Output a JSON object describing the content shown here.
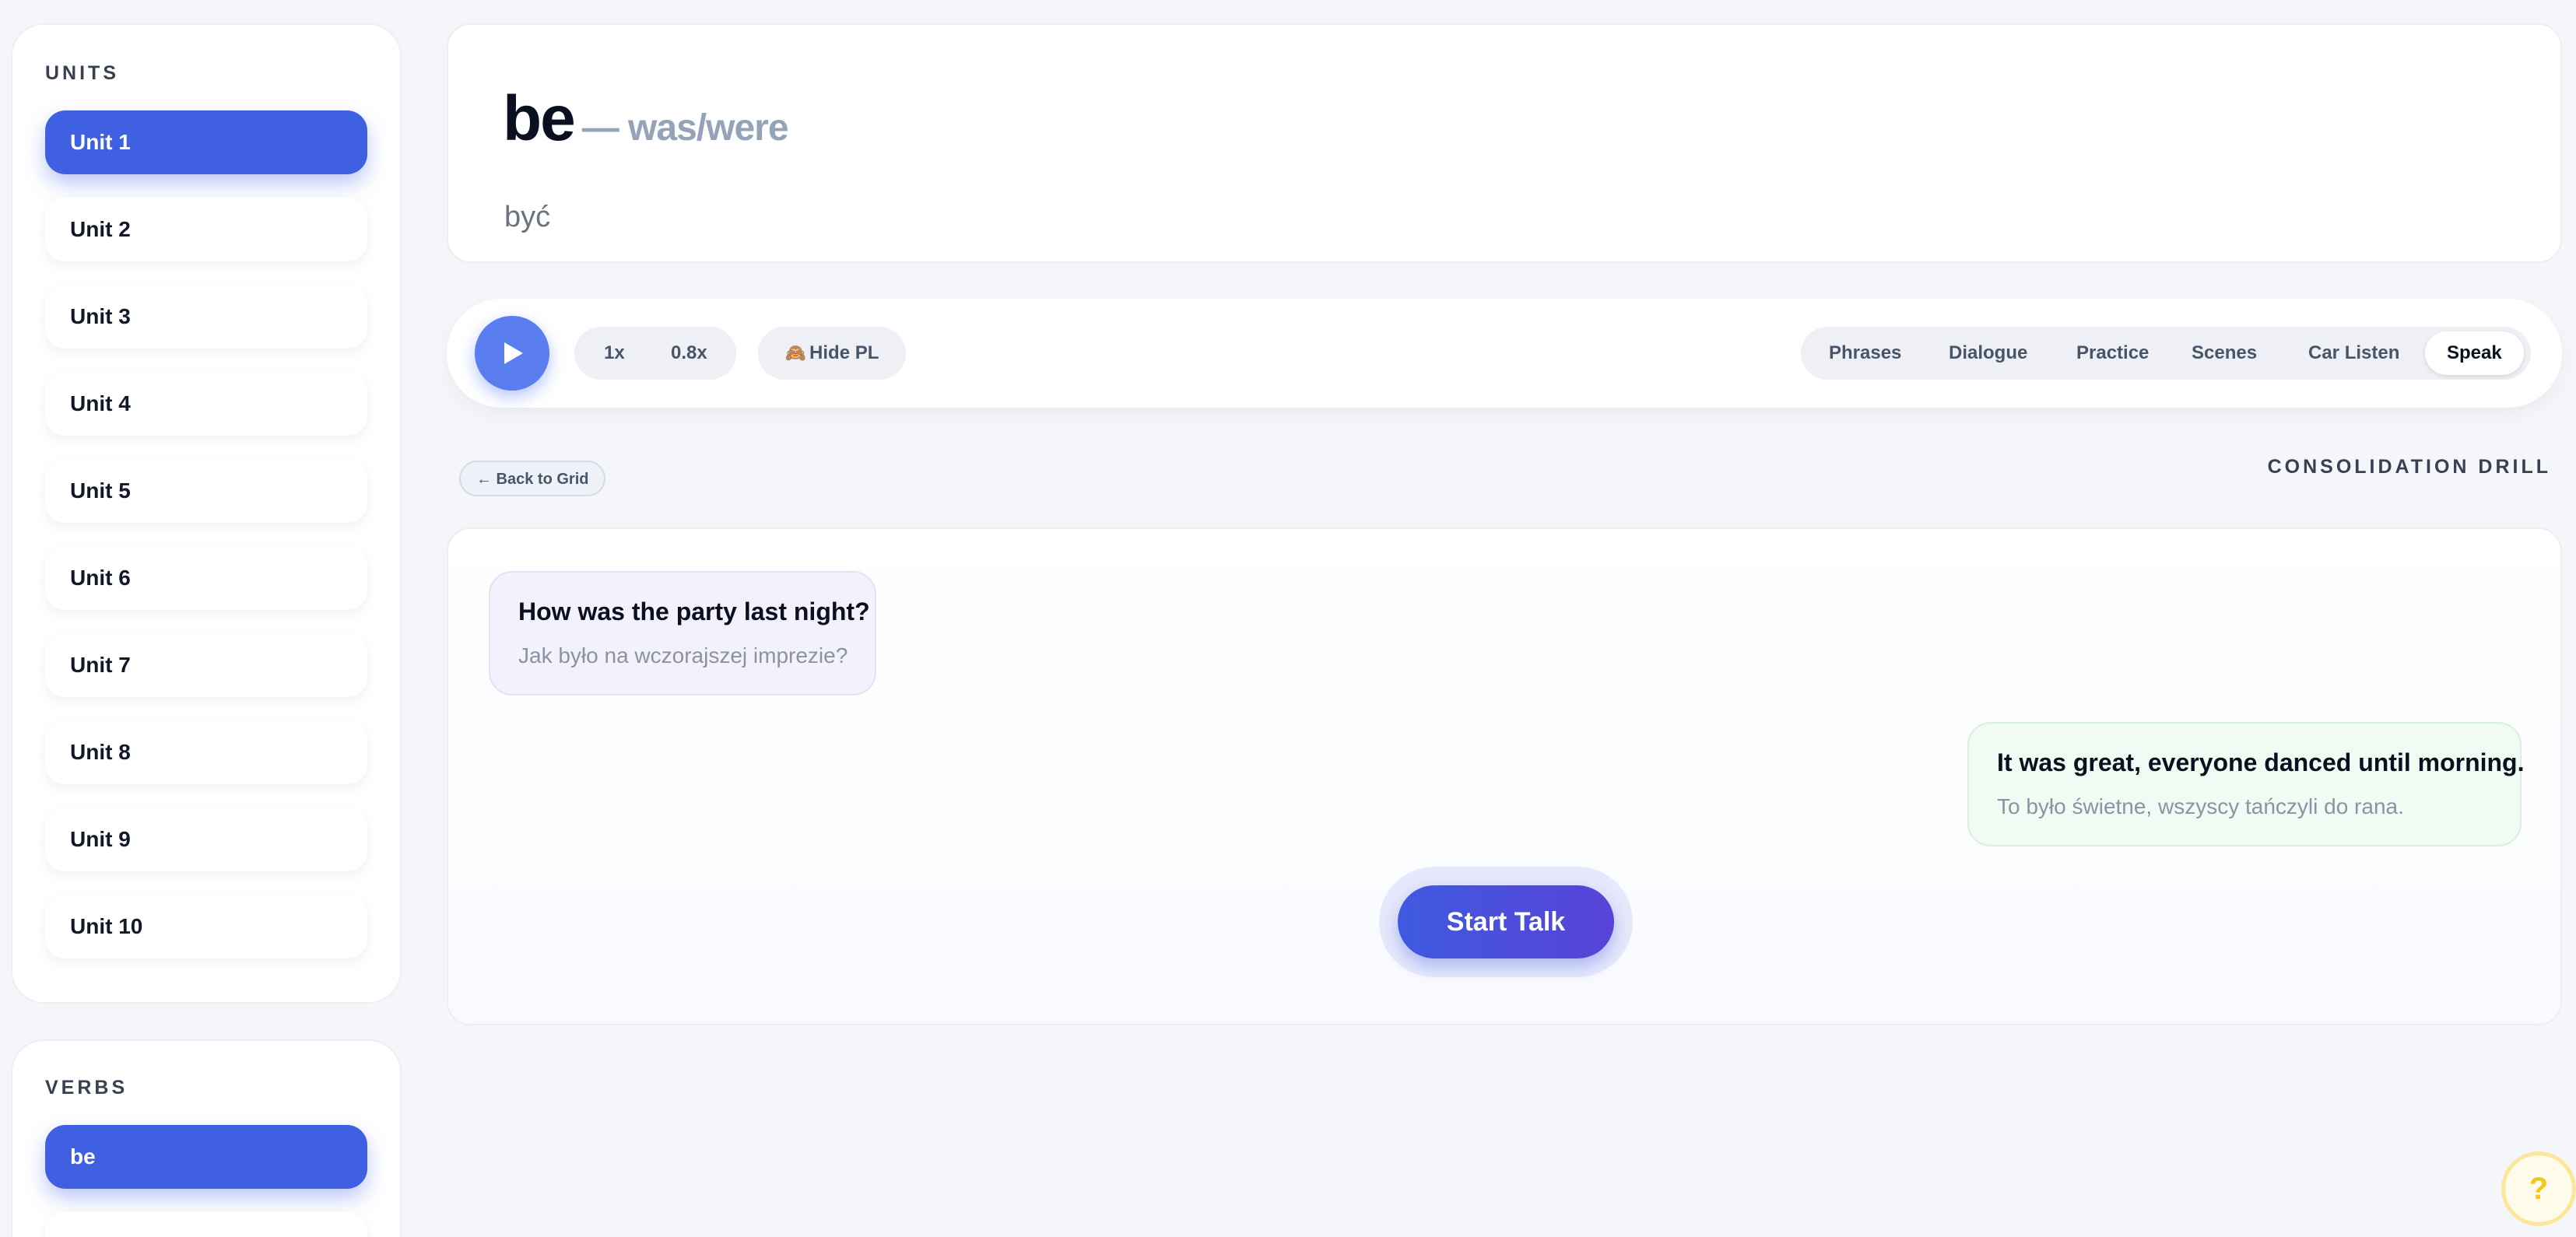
{
  "sidebar": {
    "units_title": "UNITS",
    "units": [
      {
        "label": "Unit 1",
        "active": true
      },
      {
        "label": "Unit 2",
        "active": false
      },
      {
        "label": "Unit 3",
        "active": false
      },
      {
        "label": "Unit 4",
        "active": false
      },
      {
        "label": "Unit 5",
        "active": false
      },
      {
        "label": "Unit 6",
        "active": false
      },
      {
        "label": "Unit 7",
        "active": false
      },
      {
        "label": "Unit 8",
        "active": false
      },
      {
        "label": "Unit 9",
        "active": false
      },
      {
        "label": "Unit 10",
        "active": false
      }
    ],
    "verbs_title": "VERBS",
    "verbs": [
      {
        "label": "be",
        "active": true
      },
      {
        "label": "",
        "active": false
      }
    ]
  },
  "word": {
    "base": "be",
    "forms": "— was/were",
    "translation": "być"
  },
  "toolbar": {
    "play_icon": "play-icon",
    "speed_1": "1x",
    "speed_2": "0.8x",
    "hide_pl_icon": "🙈",
    "hide_pl": "Hide PL",
    "tabs": [
      "Phrases",
      "Dialogue",
      "Practice",
      "Scenes",
      "Car Listen",
      "Speak"
    ],
    "active_tab": "Speak"
  },
  "drill": {
    "back_label": "← Back to Grid",
    "title": "CONSOLIDATION DRILL",
    "question_en": "How was the party last night?",
    "question_pl": "Jak było na wczorajszej imprezie?",
    "answer_en": "It was great, everyone danced until morning.",
    "answer_pl": "To było świetne, wszyscy tańczyli do rana.",
    "start_label": "Start Talk"
  },
  "help": {
    "label": "?",
    "icon": "help-icon"
  },
  "colors": {
    "accent": "#4060e2",
    "play": "#5a7ef0",
    "question_bubble": "#f3f2fc",
    "answer_bubble": "#f1fbf3",
    "help": "#f2c81c"
  }
}
